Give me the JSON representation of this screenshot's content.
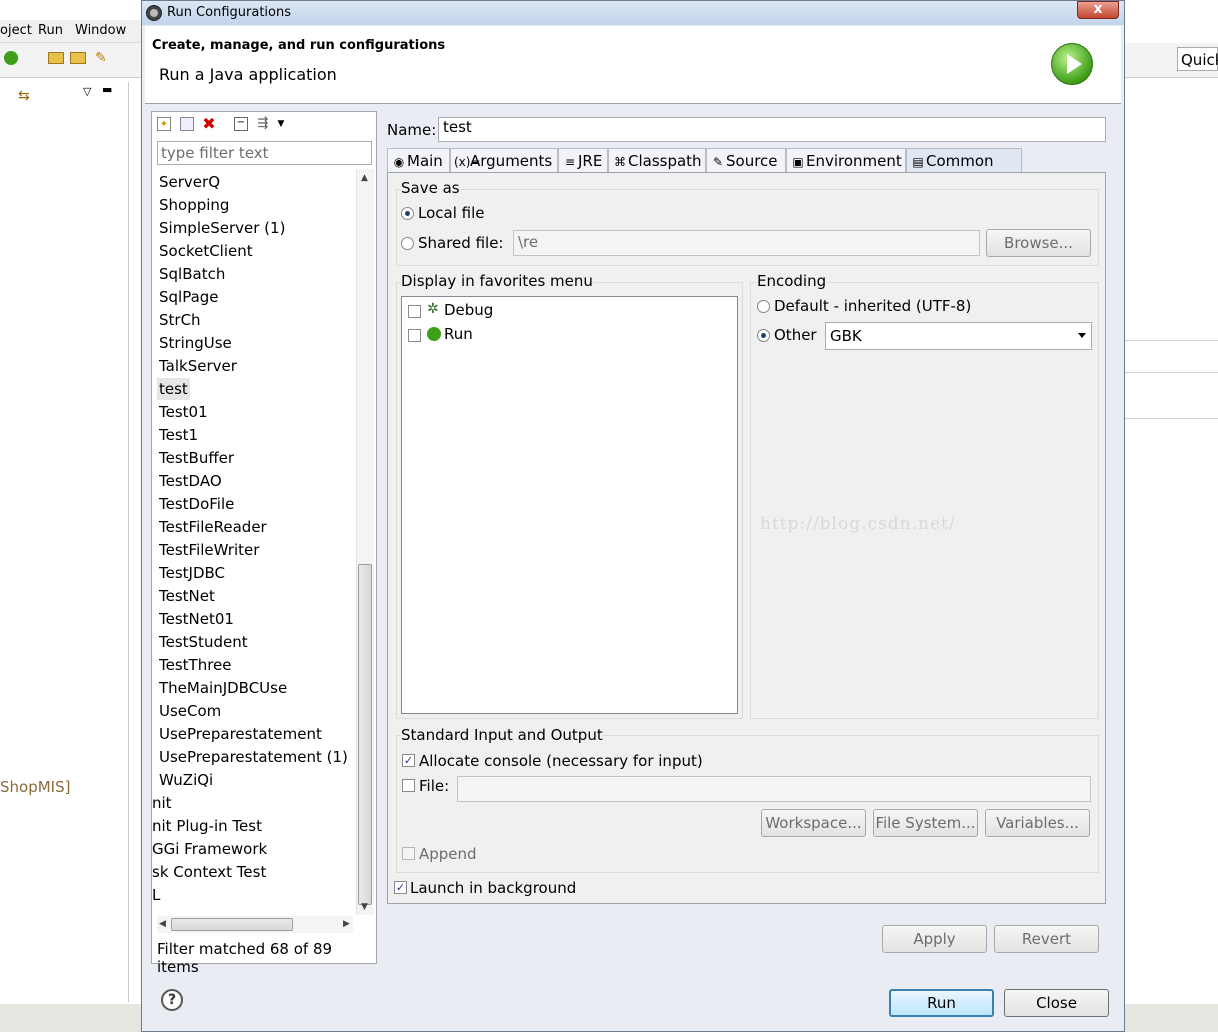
{
  "background": {
    "menu": [
      "oject",
      "Run",
      "Window"
    ],
    "quick_access": "Quick",
    "project_label": "ShopMIS]"
  },
  "dialog": {
    "title": "Run Configurations",
    "header_title": "Create, manage, and run configurations",
    "header_subtitle": "Run a Java application",
    "close_glyph": "x"
  },
  "left": {
    "toolbar_icons": [
      "new-launch-config-icon",
      "duplicate-icon",
      "delete-icon",
      "collapse-all-icon",
      "filter-icon",
      "view-menu-icon"
    ],
    "filter_placeholder": "type filter text",
    "items": [
      "ServerQ",
      "Shopping",
      "SimpleServer (1)",
      "SocketClient",
      "SqlBatch",
      "SqlPage",
      "StrCh",
      "StringUse",
      "TalkServer",
      "test",
      "Test01",
      "Test1",
      "TestBuffer",
      "TestDAO",
      "TestDoFile",
      "TestFileReader",
      "TestFileWriter",
      "TestJDBC",
      "TestNet",
      "TestNet01",
      "TestStudent",
      "TestThree",
      "TheMainJDBCUse",
      "UseCom",
      "UsePreparestatement",
      "UsePreparestatement (1)",
      "WuZiQi",
      "nit",
      "nit Plug-in Test",
      "GGi Framework",
      "sk Context Test",
      "L"
    ],
    "selected": "test",
    "filter_status": "Filter matched 68 of 89 items"
  },
  "name": {
    "label": "Name:",
    "value": "test"
  },
  "tabs": [
    {
      "label": "Main",
      "icon": "main-tab-icon",
      "glyph": "◉"
    },
    {
      "label": "Arguments",
      "icon": "arguments-tab-icon",
      "glyph": "(x)="
    },
    {
      "label": "JRE",
      "icon": "jre-tab-icon",
      "glyph": "≡"
    },
    {
      "label": "Classpath",
      "icon": "classpath-tab-icon",
      "glyph": "⌘"
    },
    {
      "label": "Source",
      "icon": "source-tab-icon",
      "glyph": "✎"
    },
    {
      "label": "Environment",
      "icon": "environment-tab-icon",
      "glyph": "▣"
    },
    {
      "label": "Common",
      "icon": "common-tab-icon",
      "glyph": "▤"
    }
  ],
  "active_tab": "Common",
  "save_as": {
    "title": "Save as",
    "local": "Local file",
    "shared": "Shared file:",
    "shared_value": "\\re",
    "browse": "Browse..."
  },
  "favorites": {
    "title": "Display in favorites menu",
    "items": [
      {
        "label": "Debug",
        "icon": "debug-icon"
      },
      {
        "label": "Run",
        "icon": "run-icon"
      }
    ]
  },
  "encoding": {
    "title": "Encoding",
    "default": "Default - inherited (UTF-8)",
    "other": "Other",
    "other_value": "GBK"
  },
  "stdio": {
    "title": "Standard Input and Output",
    "allocate": "Allocate console (necessary for input)",
    "file": "File:",
    "workspace": "Workspace...",
    "filesystem": "File System...",
    "variables": "Variables...",
    "append": "Append"
  },
  "launch_bg": "Launch in background",
  "watermark": "http://blog.csdn.net/",
  "buttons": {
    "apply": "Apply",
    "revert": "Revert",
    "run": "Run",
    "close": "Close"
  },
  "colors": {
    "accent": "#3c7fb1",
    "delete_red": "#d00000",
    "run_green": "#3f9e18"
  }
}
